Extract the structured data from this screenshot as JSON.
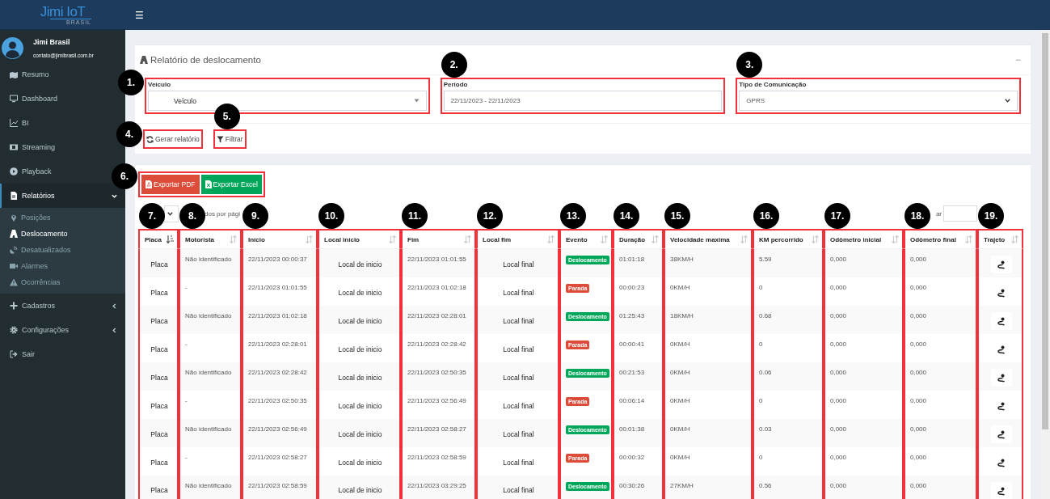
{
  "topbar": {
    "logo": "Jimi IoT",
    "logo_sub": "BRASIL",
    "menu_toggle": "☰"
  },
  "sidebar": {
    "user": {
      "name": "Jimi Brasil",
      "email": "contato@jimibrasil.com.br"
    },
    "items": [
      {
        "label": "Resumo",
        "kind": "link",
        "selected": false
      },
      {
        "label": "Dashboard",
        "kind": "link",
        "selected": false
      },
      {
        "label": "BI",
        "kind": "link",
        "selected": false
      },
      {
        "label": "Streaming",
        "kind": "link",
        "selected": false
      },
      {
        "label": "Playback",
        "kind": "link",
        "selected": false
      },
      {
        "label": "Relatórios",
        "kind": "group",
        "selected": true,
        "expanded": true,
        "children": [
          {
            "label": "Posições",
            "selected": false
          },
          {
            "label": "Deslocamento",
            "selected": true
          },
          {
            "label": "Desatualizados",
            "selected": false
          },
          {
            "label": "Alarmes",
            "selected": false
          },
          {
            "label": "Ocorrências",
            "selected": false
          }
        ]
      },
      {
        "label": "Cadastros",
        "kind": "group",
        "selected": false,
        "expanded": false
      },
      {
        "label": "Configurações",
        "kind": "group",
        "selected": false,
        "expanded": false
      },
      {
        "label": "Sair",
        "kind": "link",
        "selected": false
      }
    ]
  },
  "filter_panel": {
    "title": "Relatório de deslocamento",
    "collapse": "−",
    "fields": [
      {
        "label": "Veículo",
        "value": "Veículo",
        "kind": "combo",
        "marker": "1."
      },
      {
        "label": "Período",
        "value": "22/11/2023 - 22/11/2023",
        "kind": "text",
        "marker": "2."
      },
      {
        "label": "Tipo de Comunicação",
        "value": "GPRS",
        "kind": "select",
        "marker": "3."
      }
    ],
    "actions": [
      {
        "label": "Gerar relatório",
        "kind": "refresh",
        "marker": "4."
      },
      {
        "label": "Filtrar",
        "kind": "filter",
        "marker": "5."
      }
    ]
  },
  "results": {
    "exports": {
      "marker": "6.",
      "buttons": [
        {
          "label": "Exportar PDF",
          "kind": "pdf"
        },
        {
          "label": "Exportar Excel",
          "kind": "excel"
        }
      ]
    },
    "length_text": "dos por pági",
    "search_label": "ar",
    "table": {
      "columns": [
        {
          "label": "Placa",
          "sorted": true,
          "marker": "7."
        },
        {
          "label": "Motorista",
          "sorted": false,
          "marker": "8."
        },
        {
          "label": "Início",
          "sorted": false,
          "marker": "9."
        },
        {
          "label": "Local início",
          "sorted": false,
          "marker": "10."
        },
        {
          "label": "Fim",
          "sorted": false,
          "marker": "11."
        },
        {
          "label": "Local fim",
          "sorted": false,
          "marker": "12."
        },
        {
          "label": "Evento",
          "sorted": false,
          "marker": "13."
        },
        {
          "label": "Duração",
          "sorted": false,
          "marker": "14."
        },
        {
          "label": "Velocidade maxima",
          "sorted": false,
          "marker": "15."
        },
        {
          "label": "KM percorrido",
          "sorted": false,
          "marker": "16."
        },
        {
          "label": "Odômetro inicial",
          "sorted": false,
          "marker": "17."
        },
        {
          "label": "Odômetro final",
          "sorted": false,
          "marker": "18."
        },
        {
          "label": "Trajeto",
          "sorted": false,
          "marker": "19."
        }
      ],
      "rows": [
        {
          "placa": "Placa",
          "motorista": "Não identificado",
          "inicio": "22/11/2023 00:00:37",
          "local_inicio": "Local de inicio",
          "fim": "22/11/2023 01:01:55",
          "local_fim": "Local final",
          "evento": {
            "label": "Deslocamento",
            "kind": "moving"
          },
          "duracao": "01:01:18",
          "velocidade": "38KM/H",
          "km": "5.59",
          "odometro_inicial": "0,000",
          "odometro_final": "0,000"
        },
        {
          "placa": "Placa",
          "motorista": "-",
          "inicio": "22/11/2023 01:01:55",
          "local_inicio": "Local de inicio",
          "fim": "22/11/2023 01:02:18",
          "local_fim": "Local final",
          "evento": {
            "label": "Parada",
            "kind": "stopped"
          },
          "duracao": "00:00:23",
          "velocidade": "0KM/H",
          "km": "0",
          "odometro_inicial": "0,000",
          "odometro_final": "0,000"
        },
        {
          "placa": "Placa",
          "motorista": "Não identificado",
          "inicio": "22/11/2023 01:02:18",
          "local_inicio": "Local de inicio",
          "fim": "22/11/2023 02:28:01",
          "local_fim": "Local final",
          "evento": {
            "label": "Deslocamento",
            "kind": "moving"
          },
          "duracao": "01:25:43",
          "velocidade": "18KM/H",
          "km": "0.68",
          "odometro_inicial": "0,000",
          "odometro_final": "0,000"
        },
        {
          "placa": "Placa",
          "motorista": "-",
          "inicio": "22/11/2023 02:28:01",
          "local_inicio": "Local de inicio",
          "fim": "22/11/2023 02:28:42",
          "local_fim": "Local final",
          "evento": {
            "label": "Parada",
            "kind": "stopped"
          },
          "duracao": "00:00:41",
          "velocidade": "0KM/H",
          "km": "0",
          "odometro_inicial": "0,000",
          "odometro_final": "0,000"
        },
        {
          "placa": "Placa",
          "motorista": "Não identificado",
          "inicio": "22/11/2023 02:28:42",
          "local_inicio": "Local de inicio",
          "fim": "22/11/2023 02:50:35",
          "local_fim": "Local final",
          "evento": {
            "label": "Deslocamento",
            "kind": "moving"
          },
          "duracao": "00:21:53",
          "velocidade": "0KM/H",
          "km": "0.06",
          "odometro_inicial": "0,000",
          "odometro_final": "0,000"
        },
        {
          "placa": "Placa",
          "motorista": "-",
          "inicio": "22/11/2023 02:50:35",
          "local_inicio": "Local de inicio",
          "fim": "22/11/2023 02:56:49",
          "local_fim": "Local final",
          "evento": {
            "label": "Parada",
            "kind": "stopped"
          },
          "duracao": "00:06:14",
          "velocidade": "0KM/H",
          "km": "0",
          "odometro_inicial": "0,000",
          "odometro_final": "0,000"
        },
        {
          "placa": "Placa",
          "motorista": "Não identificado",
          "inicio": "22/11/2023 02:56:49",
          "local_inicio": "Local de inicio",
          "fim": "22/11/2023 02:58:27",
          "local_fim": "Local final",
          "evento": {
            "label": "Deslocamento",
            "kind": "moving"
          },
          "duracao": "00:01:38",
          "velocidade": "0KM/H",
          "km": "0.03",
          "odometro_inicial": "0,000",
          "odometro_final": "0,000"
        },
        {
          "placa": "Placa",
          "motorista": "-",
          "inicio": "22/11/2023 02:58:27",
          "local_inicio": "Local de inicio",
          "fim": "22/11/2023 02:58:59",
          "local_fim": "Local final",
          "evento": {
            "label": "Parada",
            "kind": "stopped"
          },
          "duracao": "00:00:32",
          "velocidade": "0KM/H",
          "km": "0",
          "odometro_inicial": "0,000",
          "odometro_final": "0,000"
        },
        {
          "placa": "Placa",
          "motorista": "Não identificado",
          "inicio": "22/11/2023 02:58:59",
          "local_inicio": "Local de inicio",
          "fim": "22/11/2023 03:29:25",
          "local_fim": "Local final",
          "evento": {
            "label": "Deslocamento",
            "kind": "moving"
          },
          "duracao": "00:30:26",
          "velocidade": "27KM/H",
          "km": "0.56",
          "odometro_inicial": "0,000",
          "odometro_final": "0,000"
        }
      ]
    }
  }
}
